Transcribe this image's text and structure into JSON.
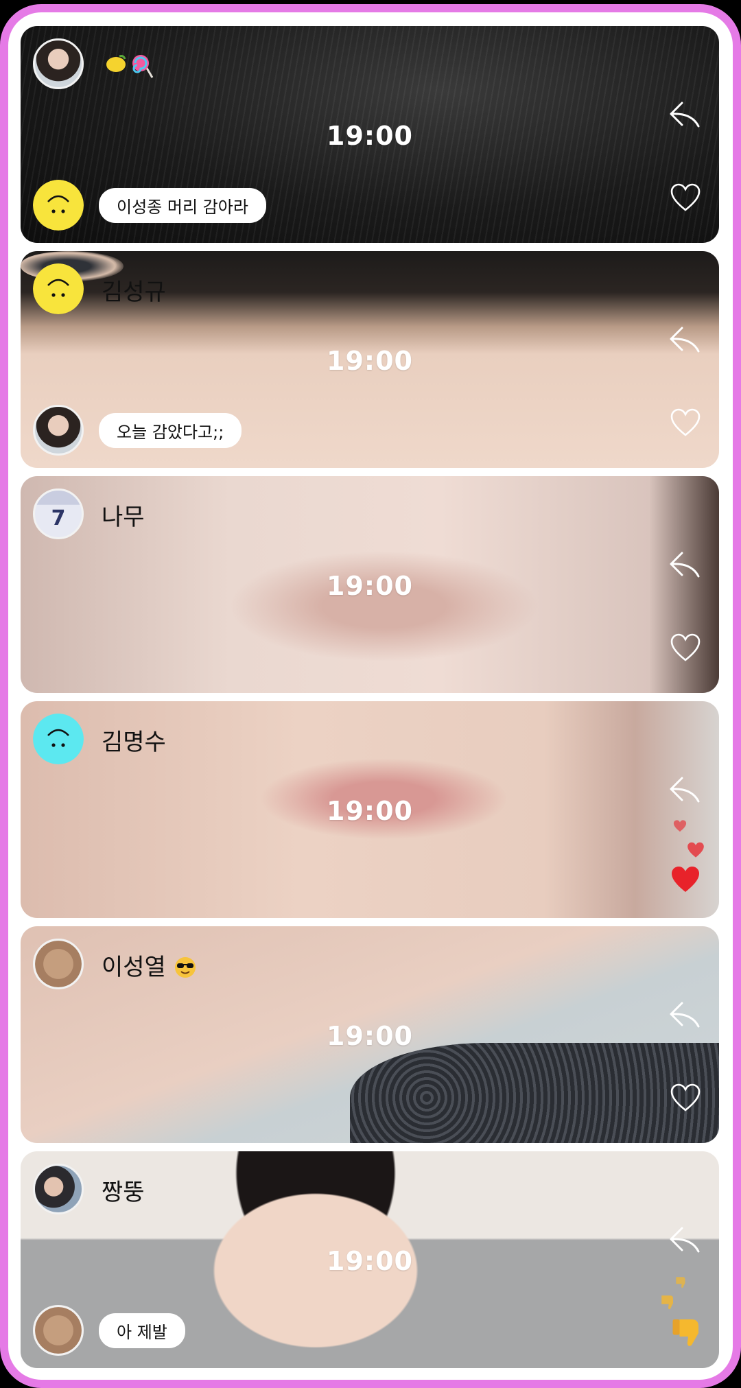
{
  "time_label": "19:00",
  "colors": {
    "frame": "#e57ae6",
    "smiley_yellow": "#f8e43c",
    "smiley_cyan": "#5ce8f0",
    "heart_red": "#e8222a",
    "thumb_yellow": "#f5b82e"
  },
  "cards": [
    {
      "name_icons": [
        "lemon-icon",
        "lollipop-icon"
      ],
      "top_avatar": "woman-photo-avatar",
      "bottom_avatar": "yellow-smiley-avatar",
      "message": "이성종 머리 감아라",
      "reaction": "heart-outline"
    },
    {
      "name": "김성규",
      "top_avatar": "yellow-smiley-avatar",
      "bottom_avatar": "woman-photo-avatar",
      "message": "오늘 감았다고;;",
      "reaction": "heart-outline"
    },
    {
      "name": "나무",
      "top_avatar": "jersey-7-avatar",
      "reaction": "heart-outline"
    },
    {
      "name": "김명수",
      "top_avatar": "cyan-smiley-avatar",
      "reaction": "hearts-filled"
    },
    {
      "name": "이성열",
      "name_emoji": "sunglasses-emoji",
      "top_avatar": "dog-photo-avatar",
      "reaction": "heart-outline"
    },
    {
      "name": "짱뚱",
      "top_avatar": "man-photo-avatar",
      "bottom_avatar": "dog-photo-avatar",
      "message": "아 제발",
      "reaction": "thumbs-down"
    }
  ]
}
